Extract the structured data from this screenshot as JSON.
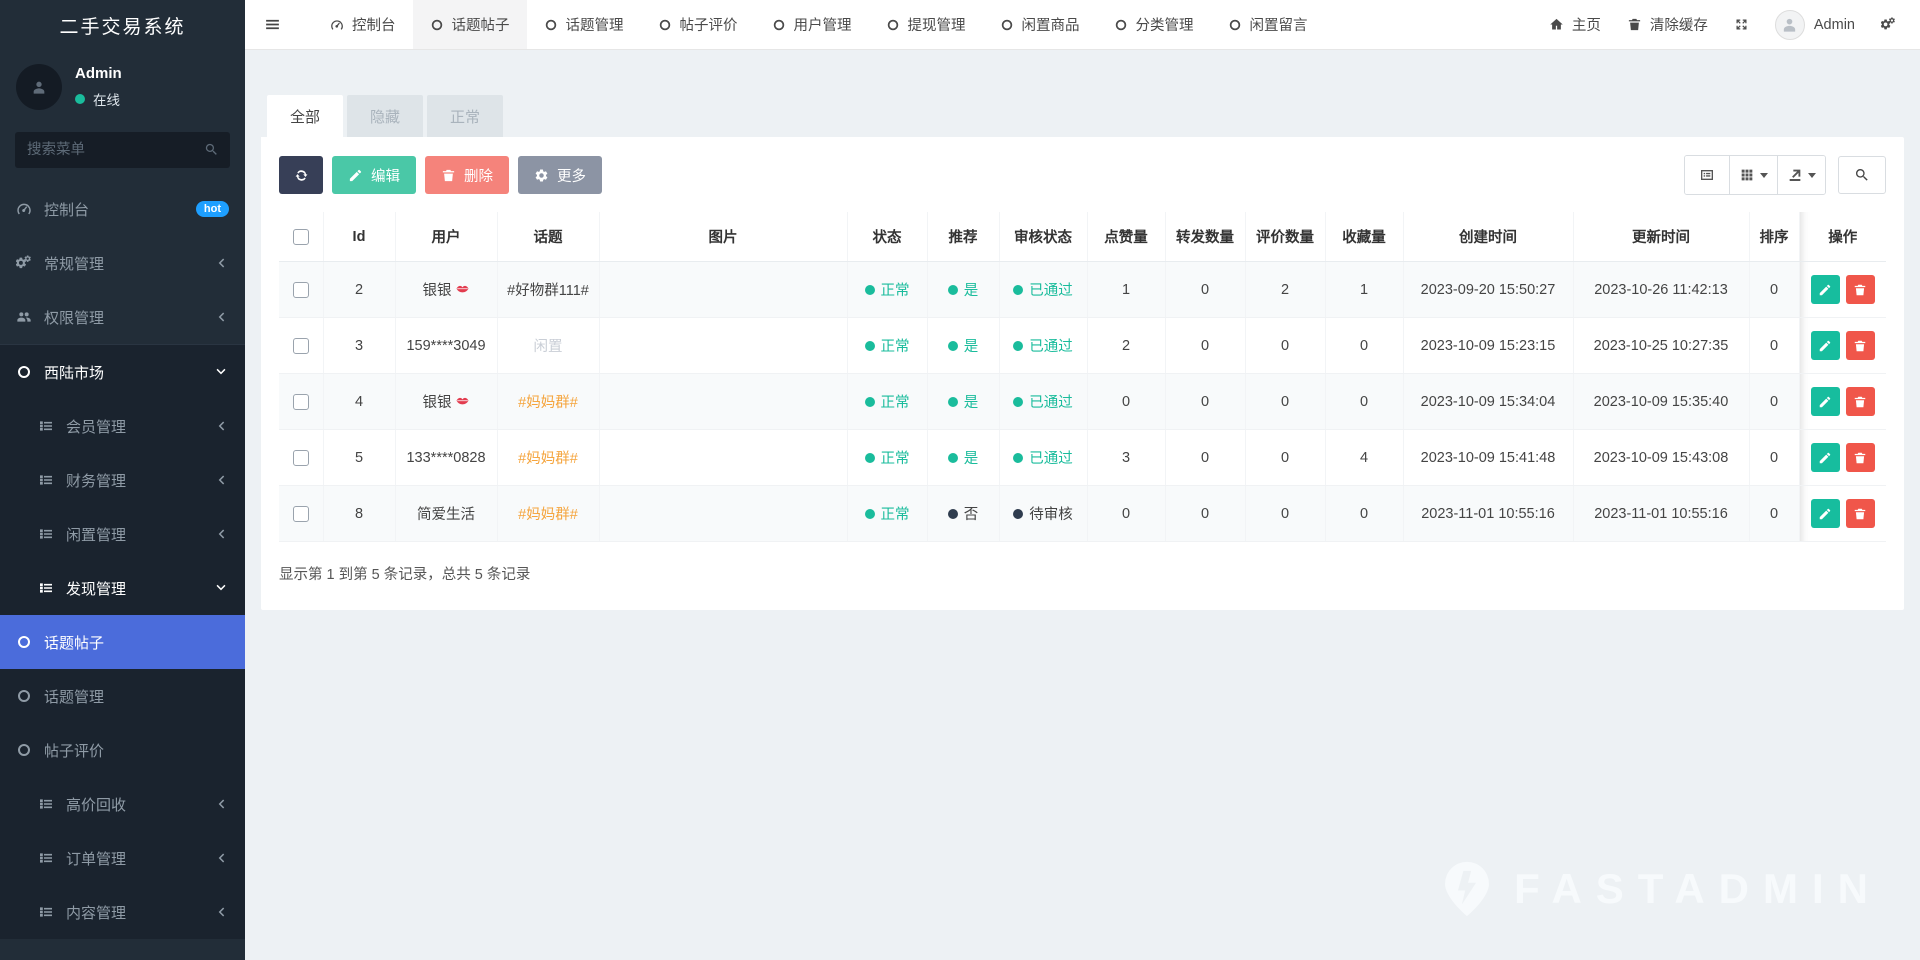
{
  "app": {
    "title": "二手交易系统"
  },
  "sidebar": {
    "user": {
      "name": "Admin",
      "status": "在线"
    },
    "search_placeholder": "搜索菜单",
    "menu": [
      {
        "label": "控制台",
        "icon": "dashboard-icon",
        "badge": "hot"
      },
      {
        "label": "常规管理",
        "icon": "cogs-icon",
        "chevron": "left"
      },
      {
        "label": "权限管理",
        "icon": "users-icon",
        "chevron": "left"
      },
      {
        "label": "西陆市场",
        "icon": "circle-icon",
        "chevron": "down",
        "emphasized": true,
        "section": true,
        "children": [
          {
            "label": "会员管理",
            "icon": "list-icon",
            "chevron": "left"
          },
          {
            "label": "财务管理",
            "icon": "list-icon",
            "chevron": "left"
          },
          {
            "label": "闲置管理",
            "icon": "list-icon",
            "chevron": "left"
          },
          {
            "label": "发现管理",
            "icon": "list-icon",
            "chevron": "down",
            "emphasized": true,
            "children": [
              {
                "label": "话题帖子",
                "icon": "circle-icon",
                "active": true
              },
              {
                "label": "话题管理",
                "icon": "circle-icon"
              },
              {
                "label": "帖子评价",
                "icon": "circle-icon"
              }
            ]
          },
          {
            "label": "高价回收",
            "icon": "list-icon",
            "chevron": "left"
          },
          {
            "label": "订单管理",
            "icon": "list-icon",
            "chevron": "left"
          },
          {
            "label": "内容管理",
            "icon": "list-icon",
            "chevron": "left"
          }
        ]
      }
    ]
  },
  "topbar": {
    "nav": [
      {
        "label": "控制台",
        "icon": "dashboard-icon"
      },
      {
        "label": "话题帖子",
        "icon": "circle-icon",
        "active": true
      },
      {
        "label": "话题管理",
        "icon": "circle-icon"
      },
      {
        "label": "帖子评价",
        "icon": "circle-icon"
      },
      {
        "label": "用户管理",
        "icon": "circle-icon"
      },
      {
        "label": "提现管理",
        "icon": "circle-icon"
      },
      {
        "label": "闲置商品",
        "icon": "circle-icon"
      },
      {
        "label": "分类管理",
        "icon": "circle-icon"
      },
      {
        "label": "闲置留言",
        "icon": "circle-icon"
      }
    ],
    "right": {
      "home": "主页",
      "clear_cache": "清除缓存",
      "username": "Admin"
    }
  },
  "main": {
    "tabs": [
      "全部",
      "隐藏",
      "正常"
    ],
    "active_tab": 0,
    "toolbar": {
      "edit": "编辑",
      "delete": "删除",
      "more": "更多"
    },
    "table": {
      "columns": [
        "Id",
        "用户",
        "话题",
        "图片",
        "状态",
        "推荐",
        "审核状态",
        "点赞量",
        "转发数量",
        "评价数量",
        "收藏量",
        "创建时间",
        "更新时间",
        "排序",
        "操作"
      ],
      "rows": [
        {
          "id": "2",
          "user": "银银",
          "user_icon": "lips-icon",
          "topic": {
            "text": "#好物群111#",
            "color": "dark"
          },
          "status": {
            "text": "正常",
            "color": "teal"
          },
          "recommend": {
            "text": "是",
            "color": "teal"
          },
          "audit": {
            "text": "已通过",
            "color": "teal"
          },
          "likes": "1",
          "forwards": "0",
          "comments": "2",
          "favorites": "1",
          "created": "2023-09-20 15:50:27",
          "updated": "2023-10-26 11:42:13",
          "sort": "0"
        },
        {
          "id": "3",
          "user": "159****3049",
          "topic": {
            "text": "闲置",
            "color": "muted"
          },
          "status": {
            "text": "正常",
            "color": "teal"
          },
          "recommend": {
            "text": "是",
            "color": "teal"
          },
          "audit": {
            "text": "已通过",
            "color": "teal"
          },
          "likes": "2",
          "forwards": "0",
          "comments": "0",
          "favorites": "0",
          "created": "2023-10-09 15:23:15",
          "updated": "2023-10-25 10:27:35",
          "sort": "0"
        },
        {
          "id": "4",
          "user": "银银",
          "user_icon": "lips-icon",
          "topic": {
            "text": "#妈妈群#",
            "color": "orange"
          },
          "status": {
            "text": "正常",
            "color": "teal"
          },
          "recommend": {
            "text": "是",
            "color": "teal"
          },
          "audit": {
            "text": "已通过",
            "color": "teal"
          },
          "likes": "0",
          "forwards": "0",
          "comments": "0",
          "favorites": "0",
          "created": "2023-10-09 15:34:04",
          "updated": "2023-10-09 15:35:40",
          "sort": "0"
        },
        {
          "id": "5",
          "user": "133****0828",
          "topic": {
            "text": "#妈妈群#",
            "color": "orange"
          },
          "status": {
            "text": "正常",
            "color": "teal"
          },
          "recommend": {
            "text": "是",
            "color": "teal"
          },
          "audit": {
            "text": "已通过",
            "color": "teal"
          },
          "likes": "3",
          "forwards": "0",
          "comments": "0",
          "favorites": "4",
          "created": "2023-10-09 15:41:48",
          "updated": "2023-10-09 15:43:08",
          "sort": "0"
        },
        {
          "id": "8",
          "user": "简爱生活",
          "topic": {
            "text": "#妈妈群#",
            "color": "orange"
          },
          "status": {
            "text": "正常",
            "color": "teal"
          },
          "recommend": {
            "text": "否",
            "color": "dark"
          },
          "audit": {
            "text": "待审核",
            "color": "dark"
          },
          "likes": "0",
          "forwards": "0",
          "comments": "0",
          "favorites": "0",
          "created": "2023-11-01 10:55:16",
          "updated": "2023-11-01 10:55:16",
          "sort": "0"
        }
      ]
    },
    "footer_text": "显示第 1 到第 5 条记录，总共 5 条记录"
  },
  "watermark": "FASTADMIN",
  "colors": {
    "accent_blue": "#4b6cdb",
    "teal": "#1abc9c",
    "danger": "#f0564a",
    "orange": "#f5a43c",
    "hot_badge": "#1e9fff",
    "dark_status": "#2f3c4e"
  }
}
